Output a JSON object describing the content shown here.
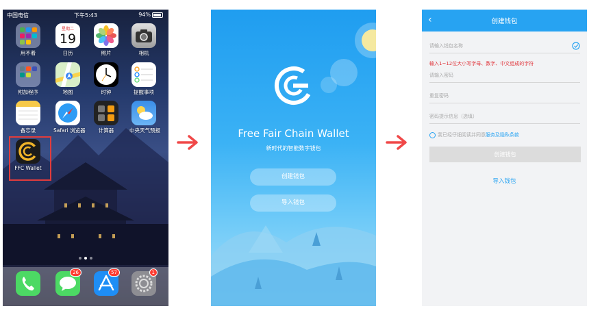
{
  "home": {
    "status": {
      "carrier": "中国电信",
      "time": "下午5:43",
      "battery": "94%"
    },
    "apps": [
      {
        "label": "用不着",
        "icon": "folder-icon"
      },
      {
        "label": "日历",
        "icon": "calendar-icon",
        "weekday": "星期二",
        "day": "19"
      },
      {
        "label": "照片",
        "icon": "photos-icon"
      },
      {
        "label": "相机",
        "icon": "camera-icon"
      },
      {
        "label": "附加程序",
        "icon": "folder-icon"
      },
      {
        "label": "地图",
        "icon": "maps-icon"
      },
      {
        "label": "时钟",
        "icon": "clock-icon"
      },
      {
        "label": "提醒事项",
        "icon": "reminders-icon"
      },
      {
        "label": "备忘录",
        "icon": "notes-icon"
      },
      {
        "label": "Safari 浏览器",
        "icon": "safari-icon"
      },
      {
        "label": "计算器",
        "icon": "calculator-icon"
      },
      {
        "label": "中央天气预报",
        "icon": "weather-icon"
      },
      {
        "label": "FFC Wallet",
        "icon": "ffc-wallet-icon"
      }
    ],
    "dock": [
      {
        "name": "phone",
        "badge": ""
      },
      {
        "name": "messages",
        "badge": "26"
      },
      {
        "name": "app-store",
        "badge": "57"
      },
      {
        "name": "settings",
        "badge": "1"
      }
    ]
  },
  "splash": {
    "title": "Free Fair Chain Wallet",
    "subtitle": "新时代的智能数字钱包",
    "create_label": "创建钱包",
    "import_label": "导入钱包"
  },
  "create": {
    "title": "创建钱包",
    "name_placeholder": "请输入钱包名称",
    "name_hint": "输入1~12位大小写字母、数字、中文组成的字符",
    "password_placeholder": "请输入密码",
    "repeat_placeholder": "重复密码",
    "hint_placeholder": "密码提示信息（选填）",
    "agree_prefix": "我已经仔细阅读并同意",
    "agree_link": "服务及隐私条款",
    "create_label": "创建钱包",
    "import_label": "导入钱包"
  },
  "colors": {
    "accent": "#27a3f2",
    "error": "#e0353b",
    "highlight": "#e23c3c",
    "arrow": "#f04848"
  }
}
